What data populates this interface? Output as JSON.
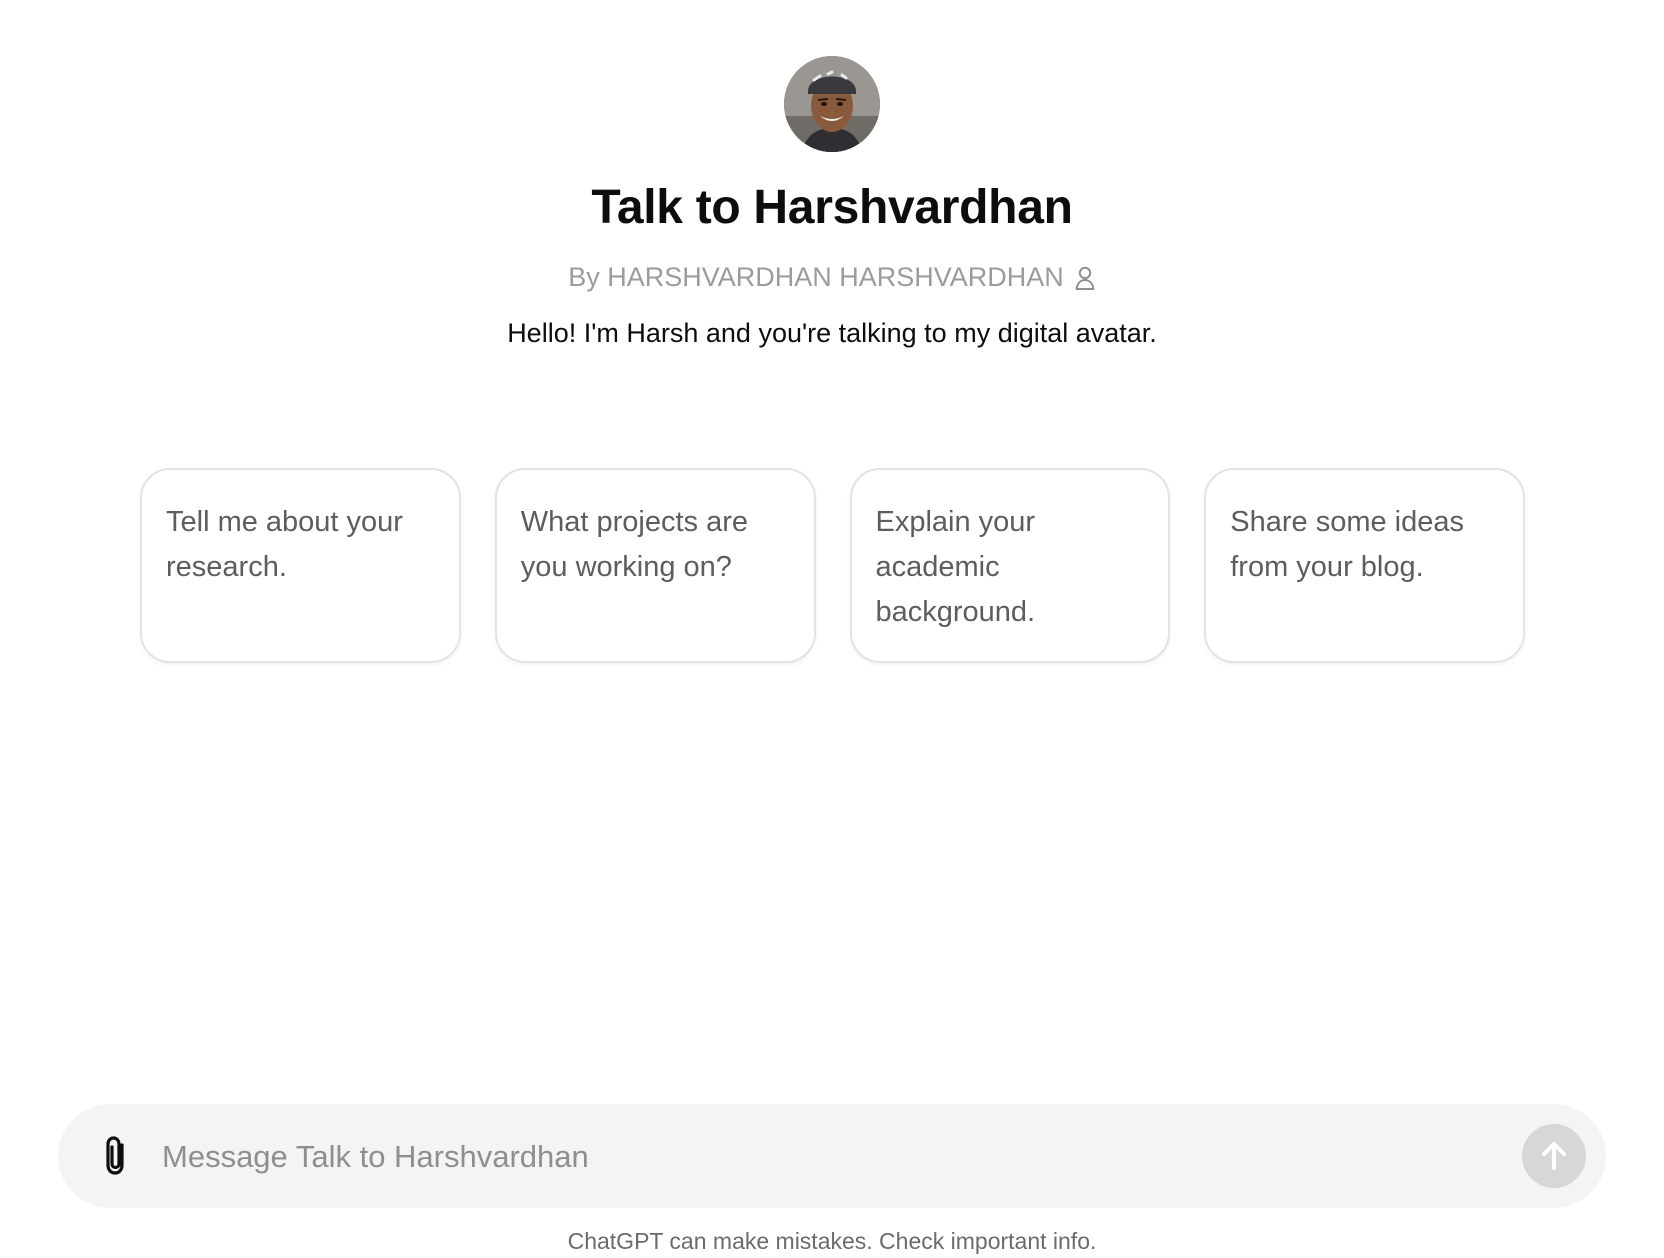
{
  "gpt": {
    "avatar_icon": "profile-photo",
    "title": "Talk to Harshvardhan",
    "byline": "By HARSHVARDHAN HARSHVARDHAN",
    "byline_icon": "person-icon",
    "description": "Hello! I'm Harsh and you're talking to my digital avatar."
  },
  "starters": [
    {
      "label": "Tell me about your research."
    },
    {
      "label": "What projects are you working on?"
    },
    {
      "label": "Explain your academic background."
    },
    {
      "label": "Share some ideas from your blog."
    }
  ],
  "composer": {
    "attach_icon": "paperclip-icon",
    "placeholder": "Message Talk to Harshvardhan",
    "value": "",
    "send_icon": "arrow-up-icon"
  },
  "footer": {
    "disclaimer": "ChatGPT can make mistakes. Check important info."
  },
  "colors": {
    "background": "#ffffff",
    "title": "#0d0d0d",
    "muted_text": "#9b9b9b",
    "starter_text": "#5d5d5d",
    "starter_border": "#e3e3e3",
    "composer_bg": "#f4f4f4",
    "send_button_disabled": "#d7d7d7"
  }
}
